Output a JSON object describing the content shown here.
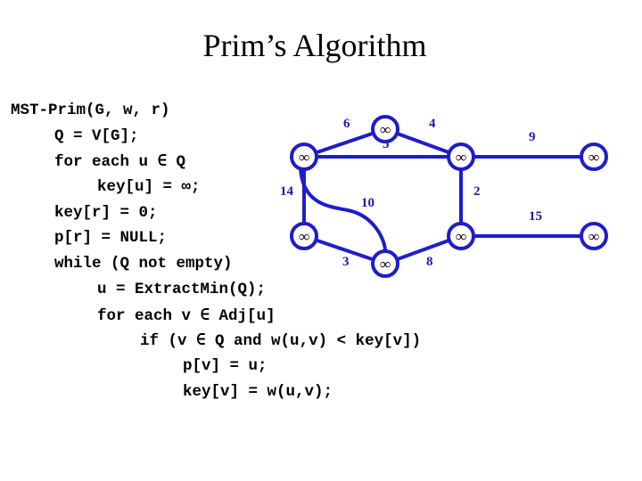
{
  "title": "Prim’s Algorithm",
  "pseudocode": [
    "MST-Prim(G, w, r)",
    "Q = V[G];",
    "for each u ∈ Q",
    "key[u] = ∞;",
    "key[r] = 0;",
    "p[r] = NULL;",
    "while (Q not empty)",
    "u = ExtractMin(Q);",
    "for each v ∈ Adj[u]",
    "if (v ∈ Q and w(u,v) < key[v])",
    "p[v] = u;",
    "key[v] = w(u,v);"
  ],
  "graph": {
    "colors": {
      "stroke": "#1e1ec8",
      "label": "#1a1aa8",
      "node_fill": "#ffffff",
      "key_text": "#000000"
    },
    "nodes": [
      {
        "id": "a",
        "key": "∞"
      },
      {
        "id": "b",
        "key": "∞"
      },
      {
        "id": "c",
        "key": "∞"
      },
      {
        "id": "d",
        "key": "∞"
      },
      {
        "id": "e",
        "key": "∞"
      },
      {
        "id": "f",
        "key": "∞"
      },
      {
        "id": "g",
        "key": "∞"
      },
      {
        "id": "h",
        "key": "∞"
      }
    ],
    "edges": [
      {
        "from": "a",
        "to": "b",
        "weight": "6"
      },
      {
        "from": "b",
        "to": "c",
        "weight": "4"
      },
      {
        "from": "a",
        "to": "c",
        "weight": "5"
      },
      {
        "from": "c",
        "to": "d",
        "weight": "9"
      },
      {
        "from": "a",
        "to": "e",
        "weight": "14"
      },
      {
        "from": "a",
        "to": "f",
        "weight": "10"
      },
      {
        "from": "c",
        "to": "g",
        "weight": "2"
      },
      {
        "from": "g",
        "to": "h",
        "weight": "15"
      },
      {
        "from": "e",
        "to": "f",
        "weight": "3"
      },
      {
        "from": "f",
        "to": "g",
        "weight": "8"
      }
    ]
  }
}
